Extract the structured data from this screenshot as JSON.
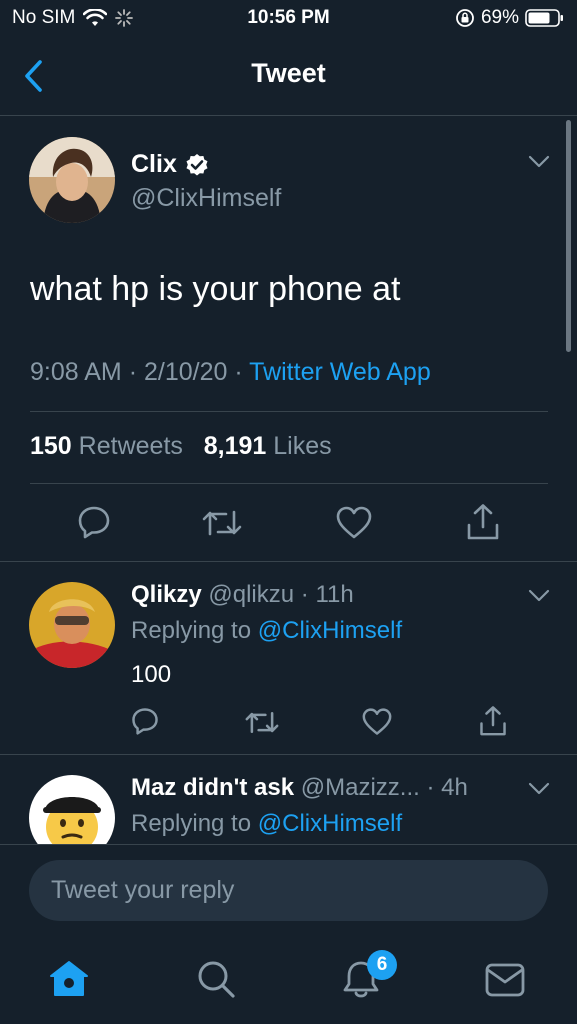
{
  "status_bar": {
    "carrier": "No SIM",
    "time": "10:56 PM",
    "battery": "69%"
  },
  "nav": {
    "title": "Tweet"
  },
  "tweet": {
    "name": "Clix",
    "handle": "@ClixHimself",
    "text": "what hp is your phone at",
    "time": "9:08 AM",
    "date": "2/10/20",
    "source": "Twitter Web App",
    "retweets_count": "150",
    "retweets_label": "Retweets",
    "likes_count": "8,191",
    "likes_label": "Likes",
    "separator": "·"
  },
  "replies": [
    {
      "name": "Qlikzy",
      "handle": "@qlikzu",
      "age": "11h",
      "replying_prefix": "Replying to",
      "replying_to": "@ClixHimself",
      "text": "100"
    },
    {
      "name": "Maz didn't ask",
      "handle": "@Mazizz...",
      "age": "4h",
      "replying_prefix": "Replying to",
      "replying_to": "@ClixHimself"
    }
  ],
  "composer": {
    "placeholder": "Tweet your reply"
  },
  "tabbar": {
    "notifications_badge": "6"
  },
  "colors": {
    "background": "#15202b",
    "accent": "#1da1f2",
    "secondary_text": "#8899a6",
    "divider": "#38444d"
  },
  "icons": {
    "back": "chevron-left-icon",
    "verified": "verified-badge-icon",
    "more": "chevron-down-icon",
    "reply": "reply-icon",
    "retweet": "retweet-icon",
    "like": "heart-icon",
    "share": "share-icon",
    "home": "home-icon",
    "search": "search-icon",
    "notifications": "bell-icon",
    "messages": "mail-icon"
  }
}
